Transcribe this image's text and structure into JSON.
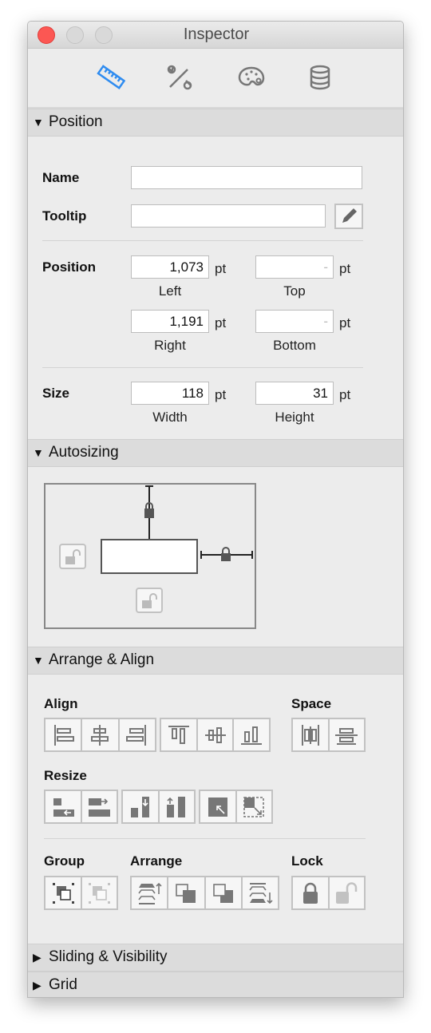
{
  "window": {
    "title": "Inspector"
  },
  "toolbar": {
    "tabs": [
      {
        "icon": "ruler-icon",
        "active": true
      },
      {
        "icon": "tools-icon"
      },
      {
        "icon": "palette-icon"
      },
      {
        "icon": "database-icon"
      }
    ],
    "accent": "#2f8cf0"
  },
  "position": {
    "header": "Position",
    "name_label": "Name",
    "name_value": "",
    "tooltip_label": "Tooltip",
    "tooltip_value": "",
    "position_label": "Position",
    "left": "1,073",
    "left_label": "Left",
    "top": "-",
    "top_label": "Top",
    "right": "1,191",
    "right_label": "Right",
    "bottom": "-",
    "bottom_label": "Bottom",
    "size_label": "Size",
    "width": "118",
    "width_label": "Width",
    "height": "31",
    "height_label": "Height",
    "unit": "pt"
  },
  "autosizing": {
    "header": "Autosizing"
  },
  "arrange": {
    "header": "Arrange & Align",
    "align_label": "Align",
    "space_label": "Space",
    "resize_label": "Resize",
    "group_label": "Group",
    "arrange_label": "Arrange",
    "lock_label": "Lock"
  },
  "sliding": {
    "header": "Sliding & Visibility"
  },
  "grid": {
    "header": "Grid"
  }
}
